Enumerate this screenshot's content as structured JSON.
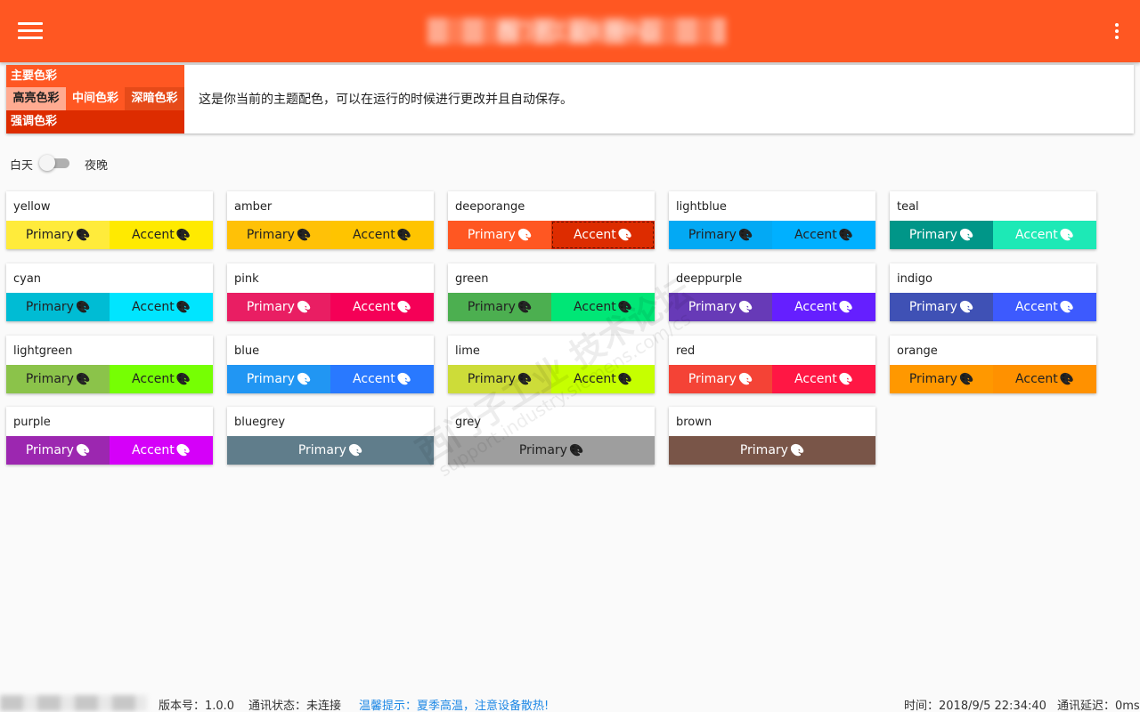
{
  "header": {
    "title": "西门子工业支持中心",
    "bg_color": "#ff5722"
  },
  "theme": {
    "primary_label": "主要色彩",
    "light_label": "高亮色彩",
    "mid_label": "中间色彩",
    "dark_label": "深暗色彩",
    "accent_label": "强调色彩",
    "description": "这是你当前的主题配色，可以在运行的时候进行更改并且自动保存。",
    "colors": {
      "primary": "#ff5722",
      "light": "#ffab91",
      "mid": "#ff5722",
      "dark": "#e64a19",
      "accent": "#dd2c00"
    }
  },
  "mode": {
    "day_label": "白天",
    "night_label": "夜晚",
    "night_on": false
  },
  "colors": [
    {
      "name": "yellow",
      "primary": "#ffeb3b",
      "accent": "#ffea00",
      "ptext": "#222",
      "atext": "#222"
    },
    {
      "name": "amber",
      "primary": "#ffc107",
      "accent": "#ffc400",
      "ptext": "#222",
      "atext": "#222"
    },
    {
      "name": "deeporange",
      "primary": "#ff5722",
      "accent": "#dd2c00",
      "ptext": "#fff",
      "atext": "#fff",
      "selected": true
    },
    {
      "name": "lightblue",
      "primary": "#03a9f4",
      "accent": "#00b0ff",
      "ptext": "#222",
      "atext": "#222"
    },
    {
      "name": "teal",
      "primary": "#009688",
      "accent": "#1de9b6",
      "ptext": "#fff",
      "atext": "#fff"
    },
    {
      "name": "cyan",
      "primary": "#00bcd4",
      "accent": "#00e5ff",
      "ptext": "#222",
      "atext": "#222"
    },
    {
      "name": "pink",
      "primary": "#e91e63",
      "accent": "#f50057",
      "ptext": "#fff",
      "atext": "#fff"
    },
    {
      "name": "green",
      "primary": "#4caf50",
      "accent": "#00e676",
      "ptext": "#222",
      "atext": "#222"
    },
    {
      "name": "deeppurple",
      "primary": "#673ab7",
      "accent": "#651fff",
      "ptext": "#fff",
      "atext": "#fff"
    },
    {
      "name": "indigo",
      "primary": "#3f51b5",
      "accent": "#3d5afe",
      "ptext": "#fff",
      "atext": "#fff"
    },
    {
      "name": "lightgreen",
      "primary": "#8bc34a",
      "accent": "#76ff03",
      "ptext": "#222",
      "atext": "#222"
    },
    {
      "name": "blue",
      "primary": "#2196f3",
      "accent": "#2979ff",
      "ptext": "#fff",
      "atext": "#fff"
    },
    {
      "name": "lime",
      "primary": "#cddc39",
      "accent": "#c6ff00",
      "ptext": "#222",
      "atext": "#222"
    },
    {
      "name": "red",
      "primary": "#f44336",
      "accent": "#ff1744",
      "ptext": "#fff",
      "atext": "#fff"
    },
    {
      "name": "orange",
      "primary": "#ff9800",
      "accent": "#ff9100",
      "ptext": "#222",
      "atext": "#222"
    },
    {
      "name": "purple",
      "primary": "#9c27b0",
      "accent": "#d500f9",
      "ptext": "#fff",
      "atext": "#fff"
    },
    {
      "name": "bluegrey",
      "primary": "#607d8b",
      "ptext": "#fff"
    },
    {
      "name": "grey",
      "primary": "#9e9e9e",
      "ptext": "#222"
    },
    {
      "name": "brown",
      "primary": "#795548",
      "ptext": "#fff"
    }
  ],
  "buttons": {
    "primary_label": "Primary",
    "accent_label": "Accent"
  },
  "footer": {
    "version": "版本号：1.0.0",
    "status": "通讯状态：未连接",
    "tip": "温馨提示：夏季高温，注意设备散热!",
    "time": "时间：2018/9/5 22:34:40",
    "delay": "通讯延迟：0ms"
  },
  "watermark": {
    "text": "西门子工业  技术论坛",
    "url": "support.industry.siemens.com/cs"
  }
}
